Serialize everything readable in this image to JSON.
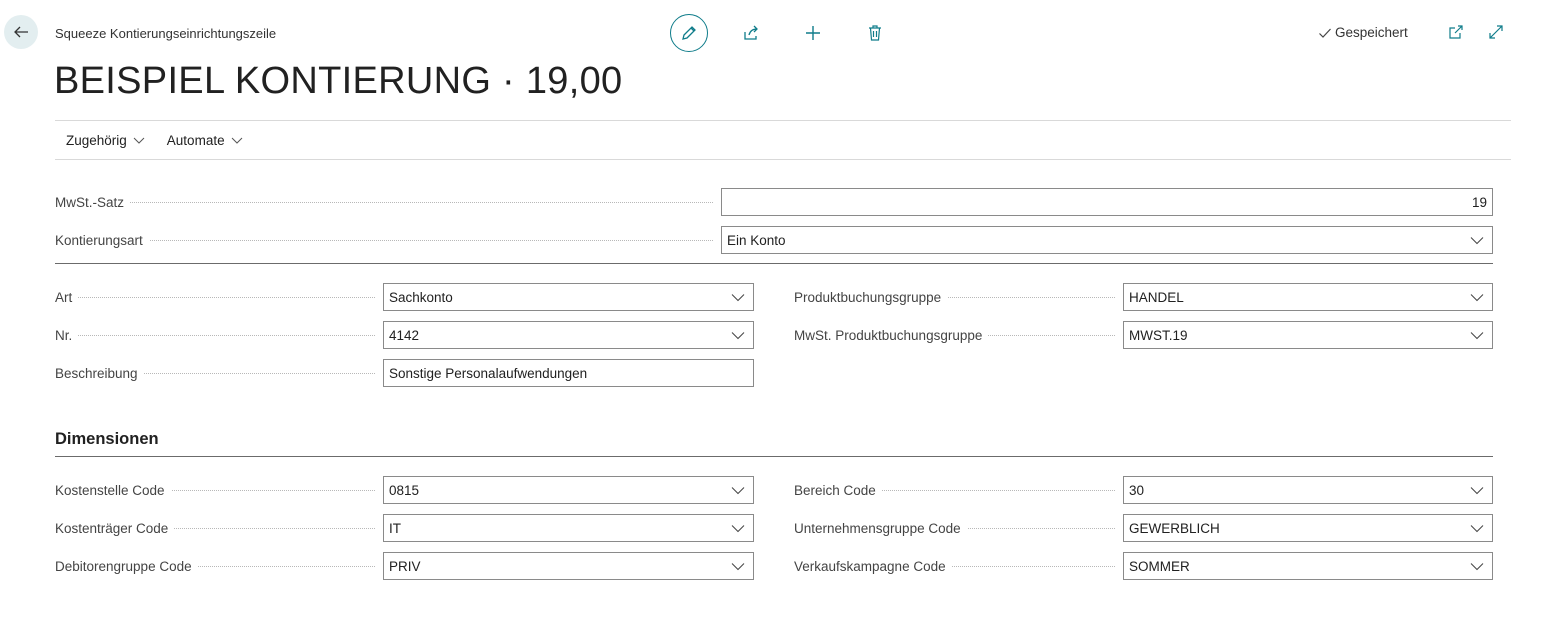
{
  "header": {
    "breadcrumb": "Squeeze Kontierungseinrichtungszeile",
    "title": "BEISPIEL KONTIERUNG · 19,00",
    "saved_label": "Gespeichert"
  },
  "actions": {
    "related": "Zugehörig",
    "automate": "Automate"
  },
  "general": {
    "vat_rate_label": "MwSt.-Satz",
    "vat_rate_value": "19",
    "posting_type_label": "Kontierungsart",
    "posting_type_value": "Ein Konto"
  },
  "line": {
    "type_label": "Art",
    "type_value": "Sachkonto",
    "no_label": "Nr.",
    "no_value": "4142",
    "description_label": "Beschreibung",
    "description_value": "Sonstige Personalaufwendungen",
    "gen_prod_label": "Produktbuchungsgruppe",
    "gen_prod_value": "HANDEL",
    "vat_prod_label": "MwSt. Produktbuchungsgruppe",
    "vat_prod_value": "MWST.19"
  },
  "dimensions": {
    "title": "Dimensionen",
    "cost_center_label": "Kostenstelle Code",
    "cost_center_value": "0815",
    "cost_object_label": "Kostenträger Code",
    "cost_object_value": "IT",
    "customer_group_label": "Debitorengruppe Code",
    "customer_group_value": "PRIV",
    "area_label": "Bereich Code",
    "area_value": "30",
    "business_group_label": "Unternehmensgruppe Code",
    "business_group_value": "GEWERBLICH",
    "sales_campaign_label": "Verkaufskampagne Code",
    "sales_campaign_value": "SOMMER"
  },
  "colors": {
    "accent": "#0f7c8a",
    "back_bg": "#e3eef0"
  }
}
